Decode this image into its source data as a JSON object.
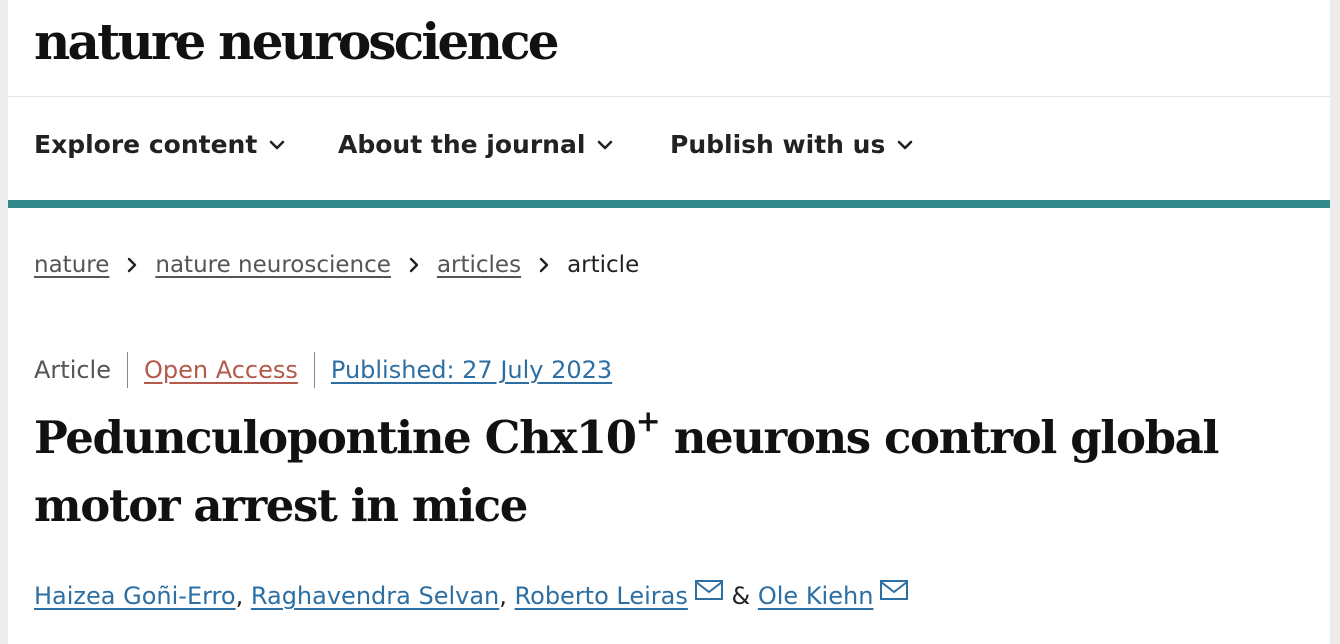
{
  "masthead": {
    "logo_text": "nature neuroscience"
  },
  "nav": {
    "items": [
      {
        "label": "Explore content"
      },
      {
        "label": "About the journal"
      },
      {
        "label": "Publish with us"
      }
    ]
  },
  "colors": {
    "accent": "#348a8a",
    "link": "#2e6fa3",
    "open_access": "#b35a4c"
  },
  "breadcrumb": {
    "items": [
      "nature",
      "nature neuroscience",
      "articles"
    ],
    "current": "article"
  },
  "article": {
    "type": "Article",
    "access": "Open Access",
    "published": "Published: 27 July 2023",
    "title_before": "Pedunculopontine Chx10",
    "title_sup": "+",
    "title_after": " neurons control global motor arrest in mice",
    "authors": [
      {
        "name": "Haizea Goñi-Erro",
        "sep": ", "
      },
      {
        "name": "Raghavendra Selvan",
        "sep": ", "
      },
      {
        "name": "Roberto Leiras",
        "sep": " & "
      },
      {
        "name": "Ole Kiehn",
        "sep": ""
      }
    ]
  }
}
